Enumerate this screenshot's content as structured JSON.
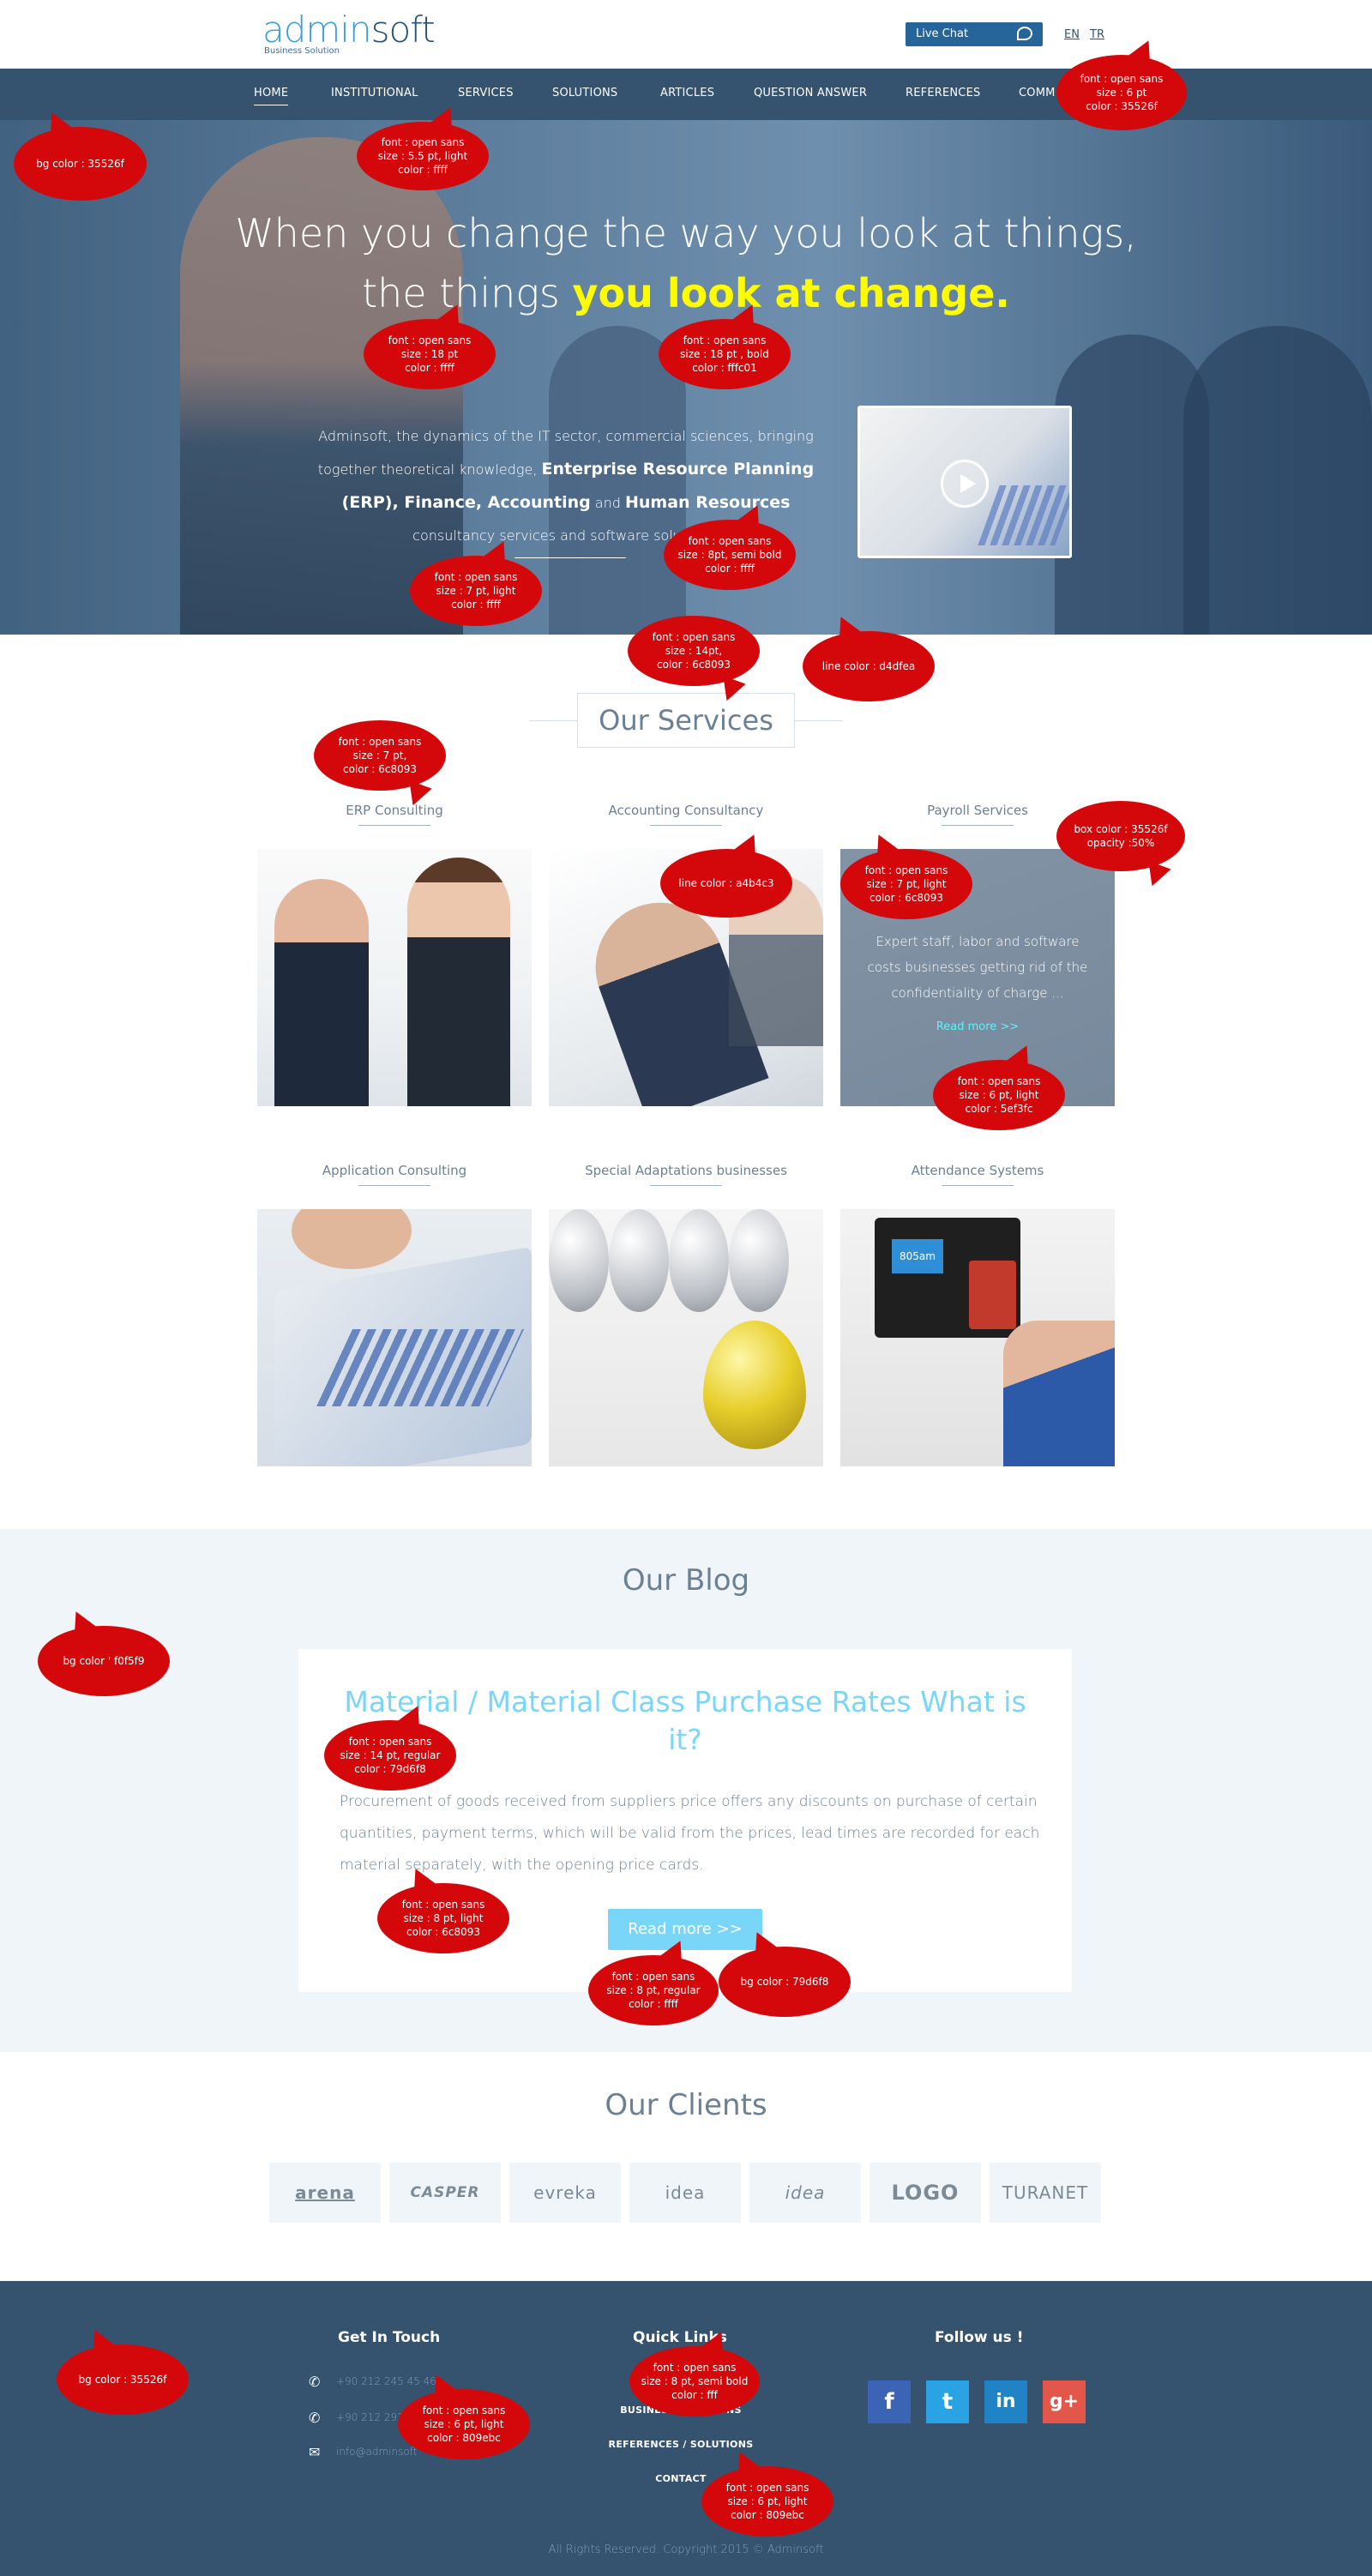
{
  "header": {
    "logo_main": "admin",
    "logo_accent": "soft",
    "logo_tagline": "Business Solution",
    "live_chat": "Live Chat",
    "lang_en": "EN",
    "lang_tr": "TR"
  },
  "nav": {
    "items": [
      "HOME",
      "INSTITUTIONAL",
      "SERVICES",
      "SOLUTIONS",
      "ARTICLES",
      "QUESTION ANSWER",
      "REFERENCES",
      "COMM"
    ]
  },
  "hero": {
    "line1": "When you change the way you look at things,",
    "line2_plain": "the things ",
    "line2_highlight": "you look at change.",
    "p_part1": "Adminsoft, the dynamics of the IT sector, commercial sciences, bringing together theoretical knowledge, ",
    "p_bold1": "Enterprise Resource Planning (ERP), Finance, Accounting",
    "p_part2": " and ",
    "p_bold2": "Human Resources",
    "p_part3": " consultancy services and software solutions."
  },
  "services": {
    "title": "Our Services",
    "items": [
      {
        "label": "ERP Consulting"
      },
      {
        "label": "Accounting Consultancy"
      },
      {
        "label": "Payroll Services"
      },
      {
        "label": "Application Consulting"
      },
      {
        "label": "Special Adaptations businesses"
      },
      {
        "label": "Attendance Systems"
      }
    ],
    "payroll_text": "Expert staff, labor and software costs businesses getting rid of the confidentiality of charge ...",
    "payroll_more": "Read more   >>",
    "attendance_screen": "805am"
  },
  "blog": {
    "title": "Our Blog",
    "post_title": "Material / Material Class Purchase Rates What is it?",
    "post_text": "Procurement of goods received from suppliers price offers any discounts on purchase of certain quantities, payment terms, which will be valid from the prices, lead times are recorded for each material separately, with the opening price cards.",
    "read_more": "Read more  >>"
  },
  "clients": {
    "title": "Our Clients",
    "logos": [
      "arena",
      "CASPER",
      "evreka",
      "idea",
      "idea",
      "LOGO",
      "TURANET"
    ]
  },
  "footer": {
    "get_in_touch": "Get In Touch",
    "phone1": "+90 212 245 45 46",
    "phone2": "+90 212 291",
    "email": "info@adminsoft",
    "quick_links": "Quick Links",
    "links": [
      "HOME",
      "BUSINESS SOLUTIONS",
      "REFERENCES / SOLUTIONS",
      "CONTACT"
    ],
    "follow_us": "Follow us !",
    "copyright": "All Rights Reserved. Copyright 2015 © Adminsoft"
  },
  "annotations": {
    "a1": [
      "bg color : 35526f"
    ],
    "a2": [
      "font : open sans",
      "size : 5.5 pt, light",
      "color : ffff"
    ],
    "a3": [
      "font : open sans",
      "size : 6 pt",
      "color : 35526f"
    ],
    "a4": [
      "font : open sans",
      "size : 18  pt",
      "color : ffff"
    ],
    "a5": [
      "font : open sans",
      "size : 18  pt , bold",
      "color : fffc01"
    ],
    "a6": [
      "font : open sans",
      "size : 8pt, semi bold",
      "color : ffff"
    ],
    "a7": [
      "font : open sans",
      "size : 7  pt, light",
      "color : ffff"
    ],
    "a8": [
      "font : open sans",
      "size : 14pt,",
      "color : 6c8093"
    ],
    "a9": [
      "line color : d4dfea"
    ],
    "a10": [
      "font : open sans",
      "size : 7 pt,",
      "color : 6c8093"
    ],
    "a11": [
      "box color : 35526f",
      "opacity :50%"
    ],
    "a12": [
      "line color : a4b4c3"
    ],
    "a13": [
      "font : open sans",
      "size : 7 pt, light",
      "color : 6c8093"
    ],
    "a14": [
      "font : open sans",
      "size : 6 pt, light",
      "color : 5ef3fc"
    ],
    "a15": [
      "bg color ' f0f5f9"
    ],
    "a16": [
      "font : open sans",
      "size : 14 pt, regular",
      "color : 79d6f8"
    ],
    "a17": [
      "font : open sans",
      "size : 8 pt, light",
      "color : 6c8093"
    ],
    "a18": [
      "font : open sans",
      "size : 8 pt, regular",
      "color : ffff"
    ],
    "a19": [
      "bg color : 79d6f8"
    ],
    "a20": [
      "bg color : 35526f"
    ],
    "a21": [
      "font : open sans",
      "size : 8 pt, semi bold",
      "color : fff"
    ],
    "a22": [
      "font : open sans",
      "size : 6 pt, light",
      "color : 809ebc"
    ],
    "a23": [
      "font : open sans",
      "size : 6 pt, light",
      "color : 809ebc"
    ]
  }
}
